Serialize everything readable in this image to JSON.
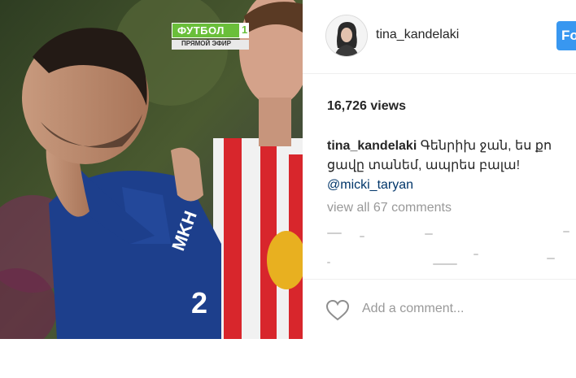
{
  "post": {
    "username": "tina_kandelaki",
    "follow_label": "Fo",
    "views": "16,726 views",
    "caption": {
      "user": "tina_kandelaki",
      "line1": "Գենրիխ ջան, ես քո",
      "line2": "ցավը տանեմ, ապրես բալա!",
      "mention": "@micki_taryan"
    },
    "view_all": "view all 67 comments",
    "add_comment_placeholder": "Add a comment..."
  },
  "broadcast": {
    "channel": "ФУТБОЛ",
    "channel_number": "1",
    "live_label": "ПРЯМОЙ ЭФИР"
  },
  "colors": {
    "follow_blue": "#3897f0",
    "mention_blue": "#003569",
    "muted_text": "#999999",
    "channel_green": "#6abf3a"
  },
  "icons": {
    "like": "heart-outline-icon"
  }
}
